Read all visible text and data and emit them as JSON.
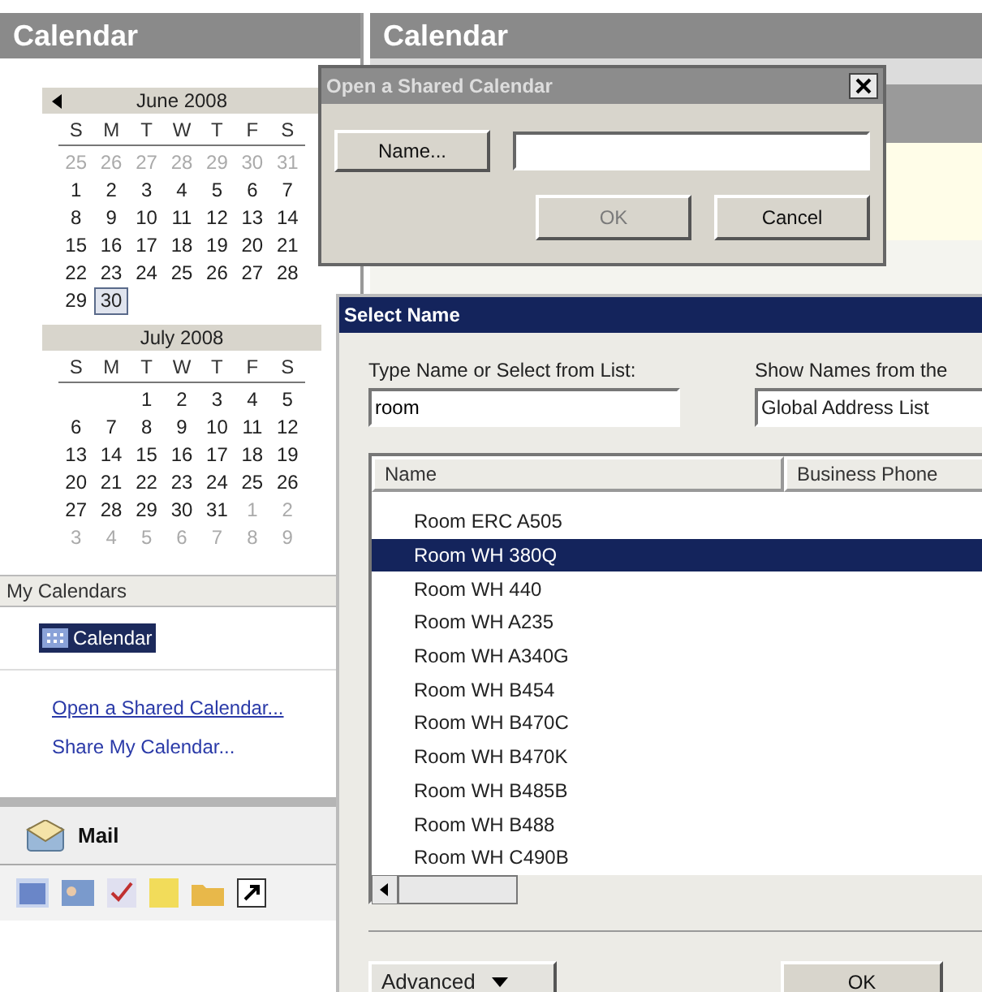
{
  "nav_pane": {
    "title": "Calendar",
    "months": [
      {
        "title": "June 2008",
        "has_prev": true,
        "weekdays": [
          "S",
          "M",
          "T",
          "W",
          "T",
          "F",
          "S"
        ],
        "weeks": [
          [
            {
              "d": "25",
              "other": true,
              "today": false
            },
            {
              "d": "26",
              "other": true,
              "today": false
            },
            {
              "d": "27",
              "other": true,
              "today": false
            },
            {
              "d": "28",
              "other": true,
              "today": false
            },
            {
              "d": "29",
              "other": true,
              "today": false
            },
            {
              "d": "30",
              "other": true,
              "today": false
            },
            {
              "d": "31",
              "other": true,
              "today": false
            }
          ],
          [
            {
              "d": "1",
              "other": false,
              "today": false
            },
            {
              "d": "2",
              "other": false,
              "today": false
            },
            {
              "d": "3",
              "other": false,
              "today": false
            },
            {
              "d": "4",
              "other": false,
              "today": false
            },
            {
              "d": "5",
              "other": false,
              "today": false
            },
            {
              "d": "6",
              "other": false,
              "today": false
            },
            {
              "d": "7",
              "other": false,
              "today": false
            }
          ],
          [
            {
              "d": "8",
              "other": false,
              "today": false
            },
            {
              "d": "9",
              "other": false,
              "today": false
            },
            {
              "d": "10",
              "other": false,
              "today": false
            },
            {
              "d": "11",
              "other": false,
              "today": false
            },
            {
              "d": "12",
              "other": false,
              "today": false
            },
            {
              "d": "13",
              "other": false,
              "today": false
            },
            {
              "d": "14",
              "other": false,
              "today": false
            }
          ],
          [
            {
              "d": "15",
              "other": false,
              "today": false
            },
            {
              "d": "16",
              "other": false,
              "today": false
            },
            {
              "d": "17",
              "other": false,
              "today": false
            },
            {
              "d": "18",
              "other": false,
              "today": false
            },
            {
              "d": "19",
              "other": false,
              "today": false
            },
            {
              "d": "20",
              "other": false,
              "today": false
            },
            {
              "d": "21",
              "other": false,
              "today": false
            }
          ],
          [
            {
              "d": "22",
              "other": false,
              "today": false
            },
            {
              "d": "23",
              "other": false,
              "today": false
            },
            {
              "d": "24",
              "other": false,
              "today": false
            },
            {
              "d": "25",
              "other": false,
              "today": false
            },
            {
              "d": "26",
              "other": false,
              "today": false
            },
            {
              "d": "27",
              "other": false,
              "today": false
            },
            {
              "d": "28",
              "other": false,
              "today": false
            }
          ],
          [
            {
              "d": "29",
              "other": false,
              "today": false
            },
            {
              "d": "30",
              "other": false,
              "today": true
            }
          ]
        ]
      },
      {
        "title": "July 2008",
        "has_prev": false,
        "first_week_partial": true,
        "weekdays": [
          "S",
          "M",
          "T",
          "W",
          "T",
          "F",
          "S"
        ],
        "weeks": [
          [
            {
              "d": "1",
              "other": false,
              "today": false
            },
            {
              "d": "2",
              "other": false,
              "today": false
            },
            {
              "d": "3",
              "other": false,
              "today": false
            },
            {
              "d": "4",
              "other": false,
              "today": false
            },
            {
              "d": "5",
              "other": false,
              "today": false
            }
          ],
          [
            {
              "d": "6",
              "other": false,
              "today": false
            },
            {
              "d": "7",
              "other": false,
              "today": false
            },
            {
              "d": "8",
              "other": false,
              "today": false
            },
            {
              "d": "9",
              "other": false,
              "today": false
            },
            {
              "d": "10",
              "other": false,
              "today": false
            },
            {
              "d": "11",
              "other": false,
              "today": false
            },
            {
              "d": "12",
              "other": false,
              "today": false
            }
          ],
          [
            {
              "d": "13",
              "other": false,
              "today": false
            },
            {
              "d": "14",
              "other": false,
              "today": false
            },
            {
              "d": "15",
              "other": false,
              "today": false
            },
            {
              "d": "16",
              "other": false,
              "today": false
            },
            {
              "d": "17",
              "other": false,
              "today": false
            },
            {
              "d": "18",
              "other": false,
              "today": false
            },
            {
              "d": "19",
              "other": false,
              "today": false
            }
          ],
          [
            {
              "d": "20",
              "other": false,
              "today": false
            },
            {
              "d": "21",
              "other": false,
              "today": false
            },
            {
              "d": "22",
              "other": false,
              "today": false
            },
            {
              "d": "23",
              "other": false,
              "today": false
            },
            {
              "d": "24",
              "other": false,
              "today": false
            },
            {
              "d": "25",
              "other": false,
              "today": false
            },
            {
              "d": "26",
              "other": false,
              "today": false
            }
          ],
          [
            {
              "d": "27",
              "other": false,
              "today": false
            },
            {
              "d": "28",
              "other": false,
              "today": false
            },
            {
              "d": "29",
              "other": false,
              "today": false
            },
            {
              "d": "30",
              "other": false,
              "today": false
            },
            {
              "d": "31",
              "other": false,
              "today": false
            },
            {
              "d": "1",
              "other": true,
              "today": false
            },
            {
              "d": "2",
              "other": true,
              "today": false
            }
          ],
          [
            {
              "d": "3",
              "other": true,
              "today": false
            },
            {
              "d": "4",
              "other": true,
              "today": false
            },
            {
              "d": "5",
              "other": true,
              "today": false
            },
            {
              "d": "6",
              "other": true,
              "today": false
            },
            {
              "d": "7",
              "other": true,
              "today": false
            },
            {
              "d": "8",
              "other": true,
              "today": false
            },
            {
              "d": "9",
              "other": true,
              "today": false
            }
          ]
        ]
      }
    ],
    "my_calendars": {
      "title": "My Calendars",
      "items": [
        {
          "label": "Calendar",
          "selected": true
        }
      ]
    },
    "links": [
      "Open a Shared Calendar...",
      "Share My Calendar..."
    ],
    "mail_button": "Mail"
  },
  "main": {
    "title": "Calendar"
  },
  "shared_dialog": {
    "title": "Open a Shared Calendar",
    "name_button": "Name...",
    "ok_button": {
      "label": "OK",
      "disabled": true
    },
    "cancel_button": {
      "label": "Cancel",
      "disabled": false
    }
  },
  "select_name": {
    "title": "Select Name",
    "search_label": "Type Name or Select from List:",
    "search_value": "room",
    "source_label": "Show Names from the",
    "source_value": "Global Address List",
    "columns": [
      "Name",
      "Business Phone"
    ],
    "rows": [
      {
        "name": "Room ERC A505",
        "selected": false
      },
      {
        "name": "Room WH 380Q",
        "selected": true
      },
      {
        "name": "Room WH 440",
        "selected": false
      },
      {
        "name": "Room WH A235",
        "selected": false
      },
      {
        "name": "Room WH A340G",
        "selected": false
      },
      {
        "name": "Room WH B454",
        "selected": false
      },
      {
        "name": "Room WH B470C",
        "selected": false
      },
      {
        "name": "Room WH B470K",
        "selected": false
      },
      {
        "name": "Room WH B485B",
        "selected": false
      },
      {
        "name": "Room WH B488",
        "selected": false
      },
      {
        "name": "Room WH C490B",
        "selected": false
      }
    ],
    "advanced_button": "Advanced",
    "ok_button": "OK"
  }
}
